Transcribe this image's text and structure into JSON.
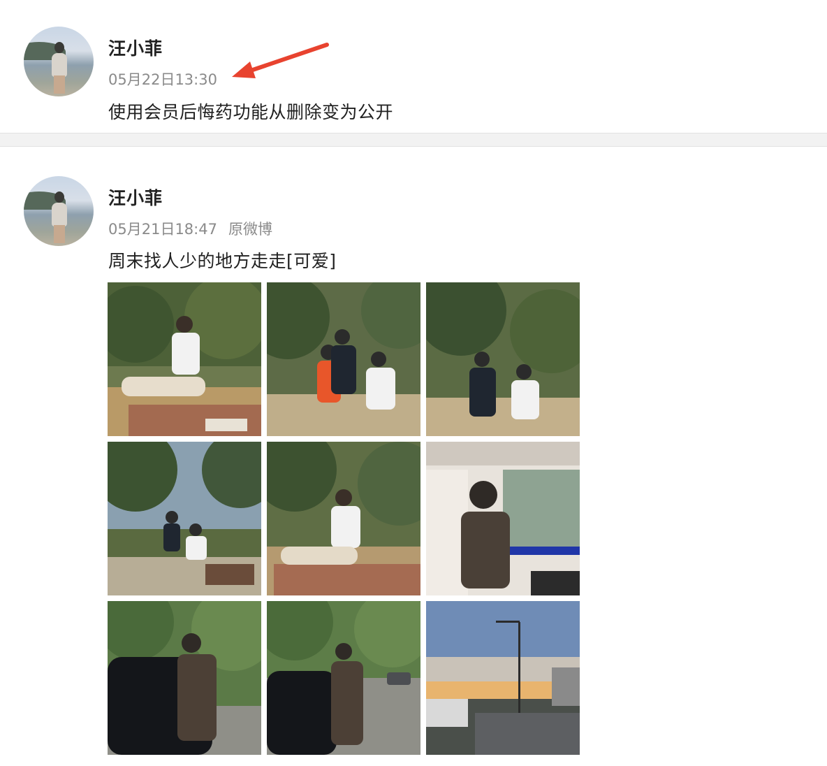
{
  "posts": [
    {
      "username": "汪小菲",
      "time": "05月22日13:30",
      "text": "使用会员后悔药功能从删除变为公开"
    },
    {
      "username": "汪小菲",
      "time": "05月21日18:47",
      "source": "原微博",
      "text": "周末找人少的地方走走[可爱]",
      "photos": [
        {
          "scene": "outdoor-picnic"
        },
        {
          "scene": "outdoor-picnic"
        },
        {
          "scene": "outdoor-picnic"
        },
        {
          "scene": "outdoor-picnic"
        },
        {
          "scene": "outdoor-picnic"
        },
        {
          "scene": "car-interior"
        },
        {
          "scene": "street-car"
        },
        {
          "scene": "street-car"
        },
        {
          "scene": "sunset-road"
        }
      ]
    }
  ],
  "colors": {
    "annotation_arrow": "#e8432f",
    "meta_text": "#8a8a8a",
    "divider": "#f2f2f2"
  }
}
